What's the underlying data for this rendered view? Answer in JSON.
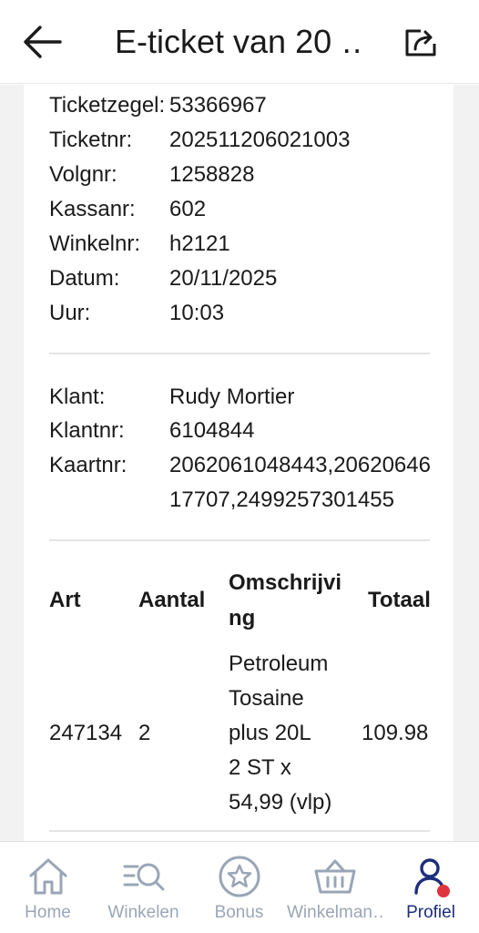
{
  "header": {
    "title": "E-ticket van 20 …"
  },
  "ticket_info": [
    {
      "label": "Ticketzegel:",
      "value": "53366967"
    },
    {
      "label": "Ticketnr:",
      "value": "202511206021003"
    },
    {
      "label": "Volgnr:",
      "value": "1258828"
    },
    {
      "label": "Kassanr:",
      "value": "602"
    },
    {
      "label": "Winkelnr:",
      "value": "h2121"
    },
    {
      "label": "Datum:",
      "value": "20/11/2025"
    },
    {
      "label": "Uur:",
      "value": "10:03"
    }
  ],
  "customer_info": [
    {
      "label": "Klant:",
      "value": "Rudy Mortier"
    },
    {
      "label": "Klantnr:",
      "value": "6104844"
    },
    {
      "label": "Kaartnr:",
      "value": "2062061048443,2062064617707,2499257301455"
    }
  ],
  "table": {
    "headers": {
      "art": "Art",
      "aantal": "Aantal",
      "omschrijving_1": "Omschrijvi",
      "omschrijving_2": "ng",
      "totaal": "Totaal"
    },
    "rows": [
      {
        "art": "247134",
        "aantal": "2",
        "omschrijving_lines": [
          "Petroleum",
          "Tosaine",
          "plus 20L",
          "2 ST x",
          "54,99 (vlp)"
        ],
        "totaal": "109.98"
      }
    ]
  },
  "tabbar": {
    "tabs": [
      {
        "label": "Home",
        "icon": "home-icon"
      },
      {
        "label": "Winkelen",
        "icon": "search-list-icon"
      },
      {
        "label": "Bonus",
        "icon": "star-icon"
      },
      {
        "label": "Winkelman…",
        "icon": "basket-icon"
      },
      {
        "label": "Profiel",
        "icon": "profile-icon"
      }
    ],
    "active": "Profiel"
  },
  "colors": {
    "accent": "#1d2f7a",
    "inactive": "#9aa6b6",
    "badge": "#e03340"
  }
}
